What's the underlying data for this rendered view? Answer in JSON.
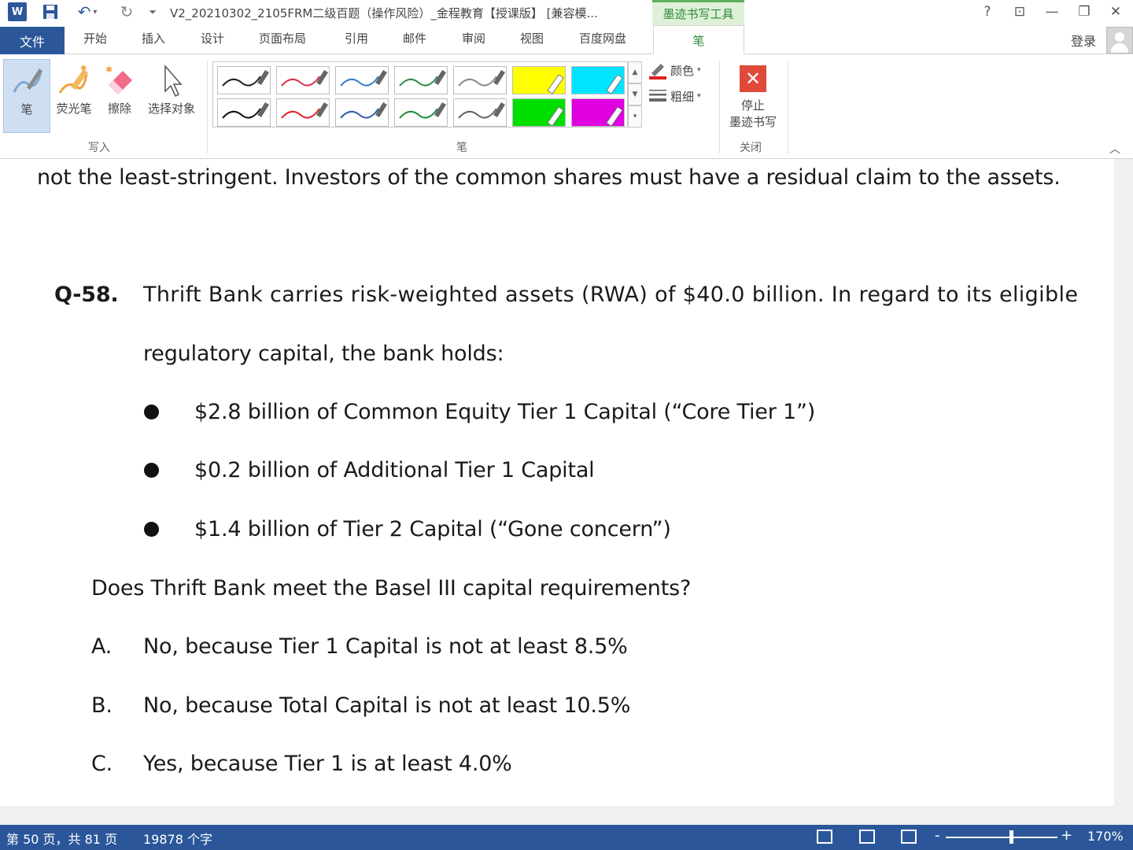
{
  "titlebar": {
    "word_logo": "W",
    "document_title": "V2_20210302_2105FRM二级百题（操作风险）_金程教育【授课版】 [兼容模...",
    "contextual_tab_title": "墨迹书写工具",
    "help": "?",
    "ribbon_display": "⊡",
    "minimize": "—",
    "restore": "❐",
    "close": "✕"
  },
  "tabs": {
    "file": "文件",
    "items": [
      "开始",
      "插入",
      "设计",
      "页面布局",
      "引用",
      "邮件",
      "审阅",
      "视图",
      "百度网盘"
    ],
    "active": "笔",
    "login": "登录"
  },
  "ribbon": {
    "write_group": {
      "label": "写入",
      "pen": "笔",
      "highlighter": "荧光笔",
      "eraser": "擦除",
      "select": "选择对象"
    },
    "pens_group": {
      "label": "笔",
      "colors": [
        "#222222",
        "#d6334a",
        "#3a7bc8",
        "#2f8a4a",
        "#8a8a8a",
        "#ffff00",
        "#00e5ff",
        "#111111",
        "#e0202a",
        "#2e5ea8",
        "#1f8a3c",
        "#666666",
        "#00e000",
        "#e000e0"
      ],
      "color": "颜色",
      "thickness": "粗细"
    },
    "close_group": {
      "label": "关闭",
      "stop_line1": "停止",
      "stop_line2": "墨迹书写"
    }
  },
  "document": {
    "top_line": "not the least-stringent. Investors of the common shares must have a residual claim to the assets.",
    "question_number": "Q-58.",
    "question_line1": "Thrift Bank carries risk-weighted assets (RWA) of $40.0 billion. In regard to its eligible",
    "question_line2": "regulatory capital, the bank holds:",
    "bullets": [
      "$2.8 billion of Common Equity Tier 1 Capital (“Core Tier 1”)",
      "$0.2 billion of Additional Tier 1 Capital",
      "$1.4 billion of Tier 2 Capital (“Gone concern”)"
    ],
    "prompt": "Does Thrift Bank meet the Basel III capital requirements?",
    "options": [
      {
        "letter": "A.",
        "text": "No, because Tier 1 Capital is not at least 8.5%"
      },
      {
        "letter": "B.",
        "text": "No, because Total Capital is not at least 10.5%"
      },
      {
        "letter": "C.",
        "text": "Yes, because Tier 1 is at least 4.0%"
      }
    ]
  },
  "statusbar": {
    "page": "第 50 页，共 81 页",
    "words": "19878 个字",
    "zoom_minus": "-",
    "zoom_plus": "+",
    "zoom": "170%"
  }
}
